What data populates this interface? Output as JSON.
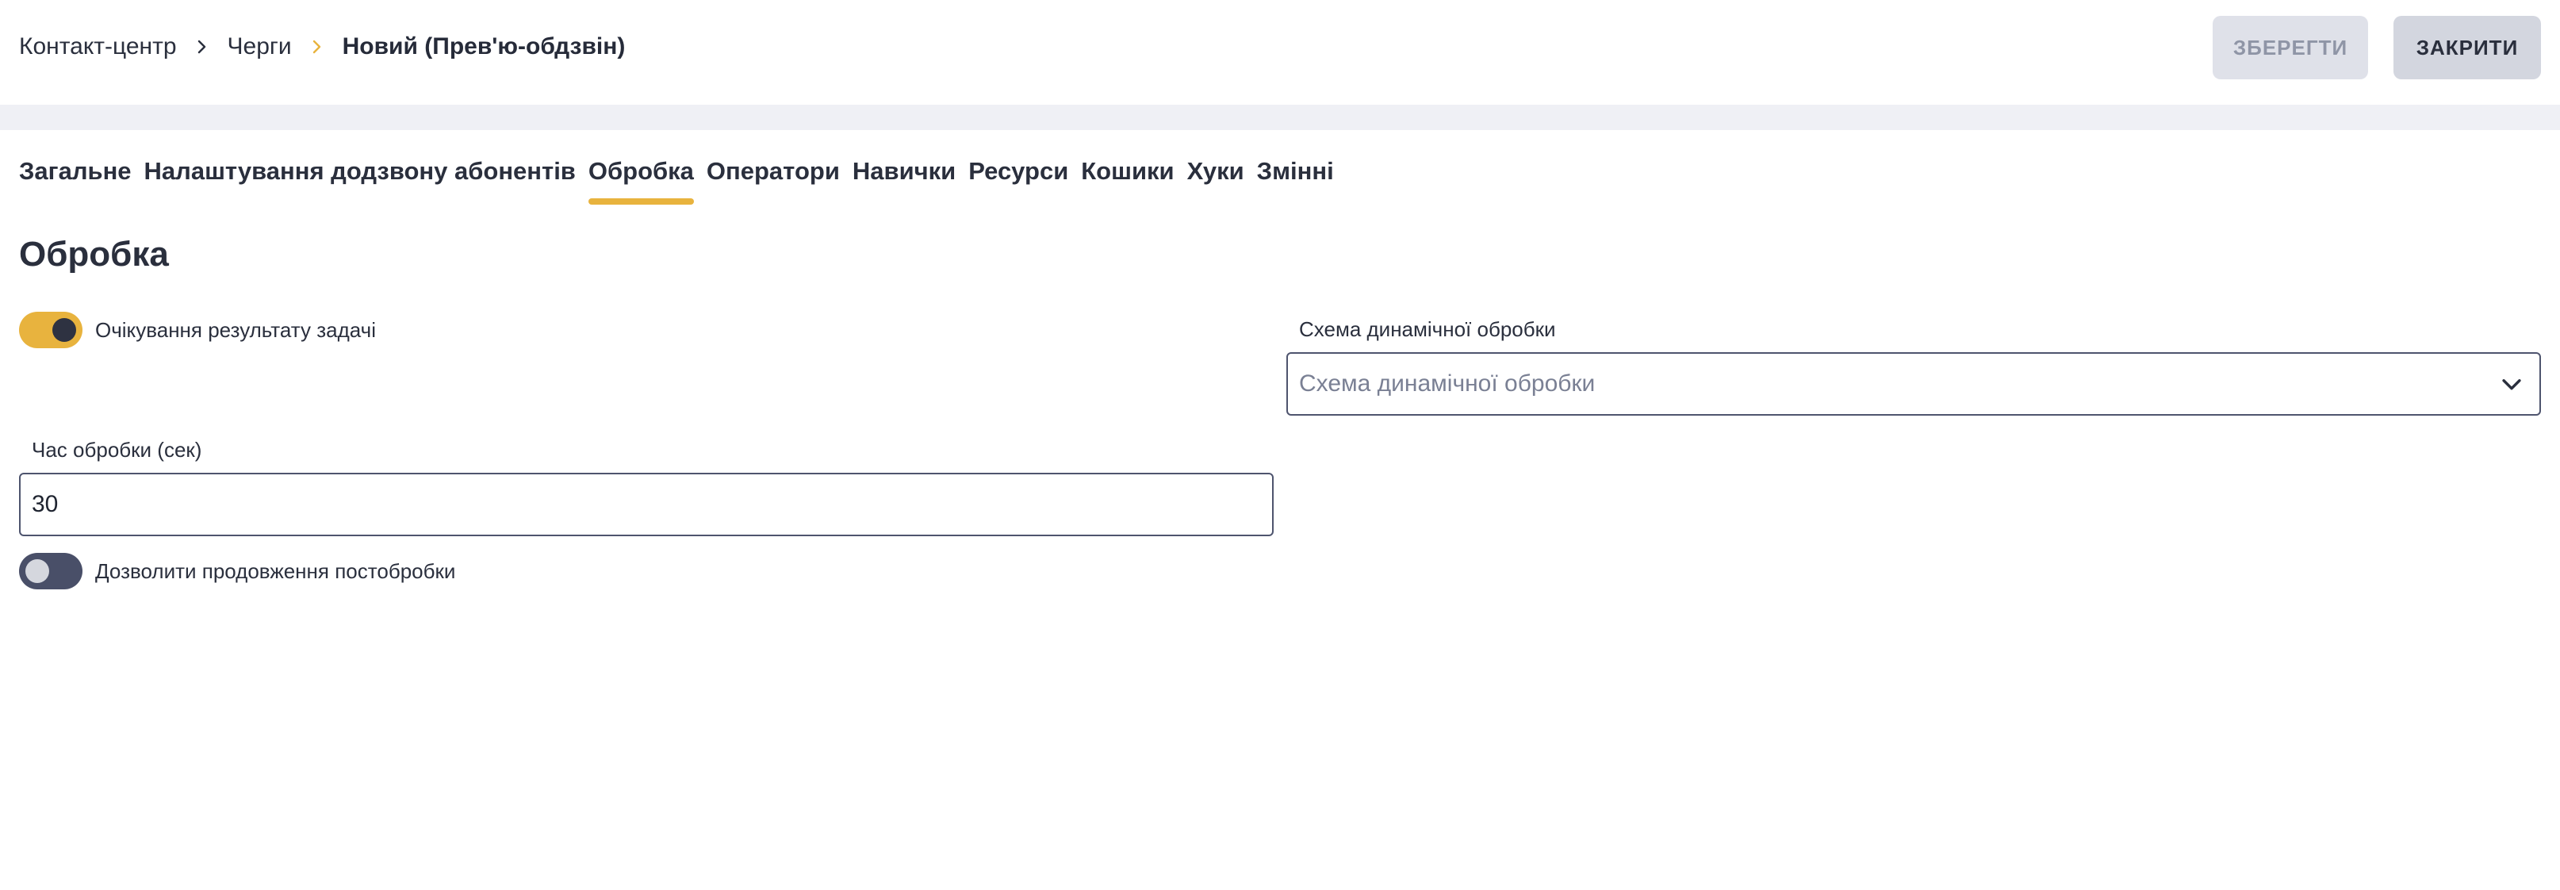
{
  "breadcrumb": {
    "items": [
      "Контакт-центр",
      "Черги",
      "Новий (Прев'ю-обдзвін)"
    ]
  },
  "toolbar": {
    "save_label": "ЗБЕРЕГТИ",
    "close_label": "ЗАКРИТИ"
  },
  "tabs": [
    {
      "label": "Загальне"
    },
    {
      "label": "Налаштування додзвону абонентів"
    },
    {
      "label": "Обробка"
    },
    {
      "label": "Оператори"
    },
    {
      "label": "Навички"
    },
    {
      "label": "Ресурси"
    },
    {
      "label": "Кошики"
    },
    {
      "label": "Хуки"
    },
    {
      "label": "Змінні"
    }
  ],
  "active_tab": "Обробка",
  "section": {
    "title": "Обробка"
  },
  "wait_result_toggle": {
    "label": "Очікування результату задачі",
    "state": "on"
  },
  "dynamic_scheme": {
    "label": "Схема динамічної обробки",
    "placeholder": "Схема динамічної обробки"
  },
  "processing_time": {
    "label": "Час обробки (сек)",
    "value": "30"
  },
  "extend_postprocessing_toggle": {
    "label": "Дозволити продовження постобробки",
    "state": "off"
  },
  "colors": {
    "accent": "#e8b33e",
    "text": "#2a2f3d",
    "toggle_off": "#494f68",
    "band": "#eff0f5"
  }
}
